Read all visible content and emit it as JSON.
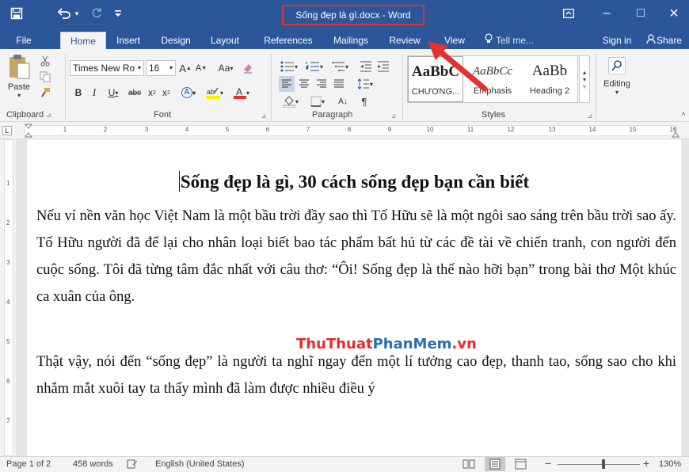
{
  "titlebar": {
    "title": "Sống đẹp là gì.docx - Word",
    "save_icon": "save-icon",
    "undo_icon": "undo-icon",
    "redo_icon": "redo-icon",
    "customize_icon": "dropdown-icon",
    "ribbon_display_icon": "ribbon-display-icon",
    "minimize_symbol": "–",
    "maximize_symbol": "□",
    "close_symbol": "×"
  },
  "tabs": {
    "file": "File",
    "home": "Home",
    "insert": "Insert",
    "design": "Design",
    "layout": "Layout",
    "references": "References",
    "mailings": "Mailings",
    "review": "Review",
    "view": "View",
    "tell_me": "Tell me...",
    "sign_in": "Sign in",
    "share": "Share"
  },
  "clipboard": {
    "paste_label": "Paste",
    "group_label": "Clipboard"
  },
  "font": {
    "font_name": "Times New Ro",
    "font_size": "16",
    "grow": "A",
    "shrink": "A",
    "change_case": "Aa",
    "bold": "B",
    "italic": "I",
    "underline": "U",
    "strikethrough": "abc",
    "subscript": "x",
    "superscript": "x",
    "group_label": "Font"
  },
  "paragraph": {
    "group_label": "Paragraph",
    "sort": "A↓",
    "pilcrow": "¶"
  },
  "styles": {
    "group_label": "Styles",
    "items": [
      {
        "preview": "AaBbC",
        "name": "CHƯƠNG..."
      },
      {
        "preview": "AaBbCc",
        "name": "Emphasis"
      },
      {
        "preview": "AaBb",
        "name": "Heading 2"
      }
    ]
  },
  "editing": {
    "label": "Editing"
  },
  "ruler_numbers": [
    "1",
    "2",
    "3",
    "4",
    "5",
    "6",
    "7",
    "8",
    "9",
    "10",
    "11",
    "12",
    "13",
    "14",
    "15",
    "16"
  ],
  "vruler_numbers": [
    "1",
    "2",
    "3",
    "4",
    "5",
    "6",
    "7"
  ],
  "document": {
    "title": "Sống đẹp là gì, 30 cách sống đẹp bạn cần biết",
    "paragraph_1": "Nếu ví nền văn học Việt Nam là một bầu trời đầy sao thì Tố Hữu sẽ là một ngôi sao sáng trên bầu trời sao ấy. Tố Hữu người đã để lại cho nhân loại biết bao tác phẩm bất hủ từ các đề tài về chiến tranh, con người đến cuộc sống. Tôi đã từng tâm đắc nhất với câu thơ:  “Ôi! Sống đẹp là thế nào hỡi bạn” trong bài thơ Một khúc ca xuân của ông.",
    "paragraph_2": "Thật vậy, nói đến “sống đẹp” là người ta nghĩ ngay đến một lí tưởng cao đẹp, thanh tao, sống sao cho khi nhắm mắt xuôi tay ta thấy mình đã làm được nhiều điều ý"
  },
  "watermark": {
    "part1": "ThuThuat",
    "part2": "PhanMem",
    "part3": ".vn"
  },
  "statusbar": {
    "page": "Page 1 of 2",
    "words": "458 words",
    "language": "English (United States)",
    "zoom_minus": "−",
    "zoom_plus": "+",
    "zoom": "130%",
    "zoom_level_fraction": 0.56
  },
  "colors": {
    "ribbon_blue": "#2b579a",
    "highlight_red": "#e2322e",
    "watermark_red": "#e62b2b",
    "watermark_blue": "#2b6cb0"
  }
}
